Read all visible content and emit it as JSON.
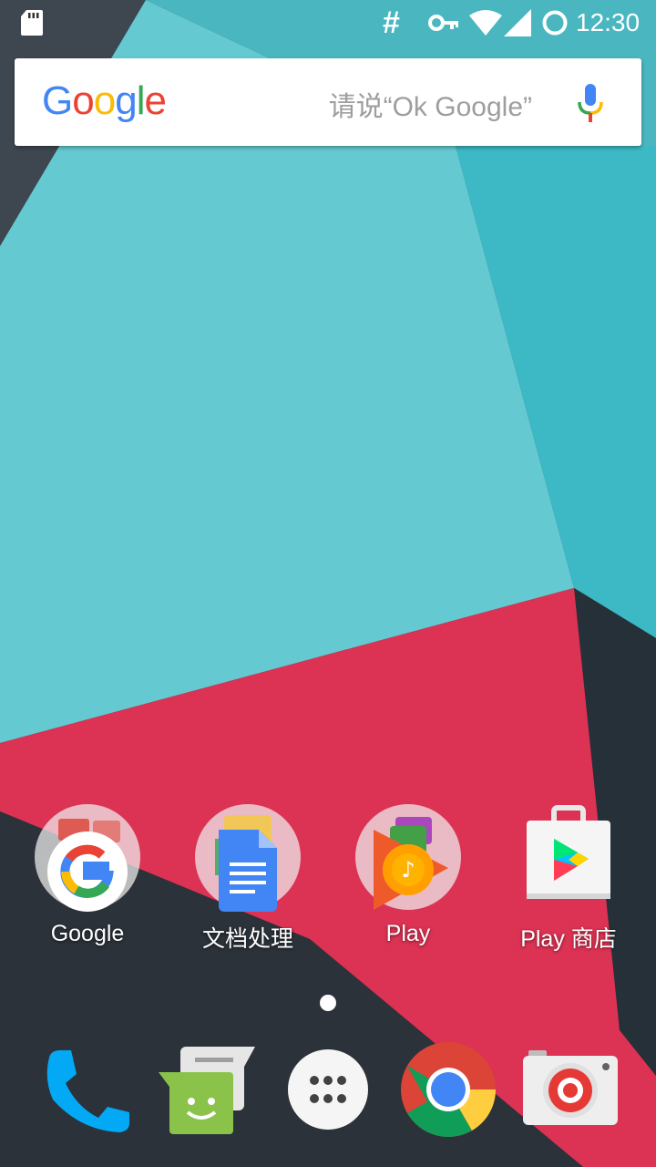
{
  "status_bar": {
    "time": "12:30",
    "icons": [
      "sd-card-icon",
      "hash-icon",
      "vpn-key-icon",
      "wifi-icon",
      "signal-icon",
      "battery-icon"
    ],
    "hash_symbol": "#"
  },
  "search": {
    "logo": [
      "G",
      "o",
      "o",
      "g",
      "l",
      "e"
    ],
    "logo_colors": [
      "#4285F4",
      "#EA4335",
      "#FBBC05",
      "#4285F4",
      "#34A853",
      "#EA4335"
    ],
    "hint": "请说“Ok Google”",
    "mic_icon": "mic-icon"
  },
  "apps": [
    {
      "label": "Google",
      "icon": "google-folder-icon"
    },
    {
      "label": "文档处理",
      "icon": "docs-folder-icon"
    },
    {
      "label": "Play",
      "icon": "play-folder-icon"
    },
    {
      "label": "Play 商店",
      "icon": "play-store-icon"
    }
  ],
  "dock": [
    {
      "icon": "phone-icon"
    },
    {
      "icon": "messenger-icon"
    },
    {
      "icon": "app-drawer-icon"
    },
    {
      "icon": "chrome-icon"
    },
    {
      "icon": "camera-icon"
    }
  ],
  "colors": {
    "teal_light": "#63c9d2",
    "teal": "#3bb8c4",
    "red": "#d93050",
    "dark": "#2b3239"
  }
}
